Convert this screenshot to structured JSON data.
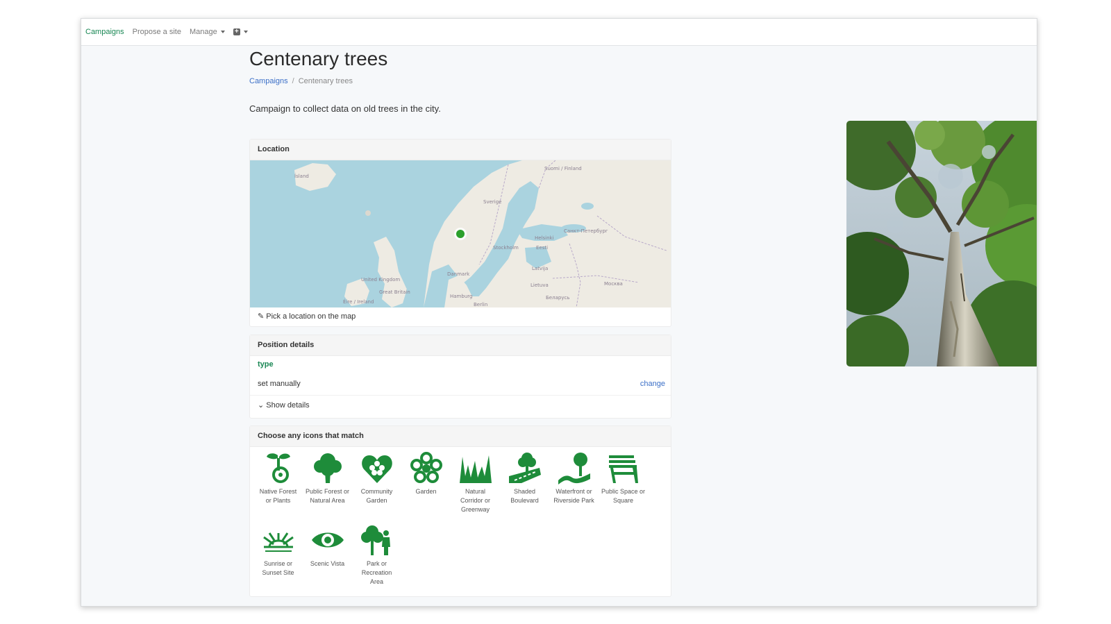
{
  "nav": {
    "campaigns": "Campaigns",
    "propose": "Propose a site",
    "manage": "Manage"
  },
  "page": {
    "title": "Centenary trees",
    "breadcrumb_root": "Campaigns",
    "breadcrumb_current": "Centenary trees",
    "description": "Campaign to collect data on old trees in the city."
  },
  "location": {
    "header": "Location",
    "pick_label": "Pick a location on the map",
    "map_labels": [
      "Ísland",
      "Sverige",
      "Suomi / Finland",
      "Stockholm",
      "Helsinki",
      "Eesti",
      "Latvija",
      "Lietuva",
      "Москва",
      "Danmark",
      "Hamburg",
      "Berlin",
      "Беларусь",
      "United Kingdom",
      "Great Britain",
      "Éire / Ireland",
      "Санкт-Петербург"
    ]
  },
  "position": {
    "header": "Position details",
    "type_label": "type",
    "type_value": "set manually",
    "change_label": "change",
    "show_details": "Show details"
  },
  "icons": {
    "header": "Choose any icons that match",
    "color": "#1e8c3a",
    "items": [
      {
        "icon": "sprout-icon",
        "label": "Native Forest or Plants"
      },
      {
        "icon": "tree-icon",
        "label": "Public Forest or Natural Area"
      },
      {
        "icon": "heart-flower-icon",
        "label": "Community Garden"
      },
      {
        "icon": "flower-icon",
        "label": "Garden"
      },
      {
        "icon": "grass-icon",
        "label": "Natural Corridor or Greenway"
      },
      {
        "icon": "boulevard-icon",
        "label": "Shaded Boulevard"
      },
      {
        "icon": "riverside-tree-icon",
        "label": "Waterfront or Riverside Park"
      },
      {
        "icon": "bench-icon",
        "label": "Public Space or Square"
      },
      {
        "icon": "sunrise-icon",
        "label": "Sunrise or Sunset Site"
      },
      {
        "icon": "eye-icon",
        "label": "Scenic Vista"
      },
      {
        "icon": "park-person-icon",
        "label": "Park or Recreation Area"
      }
    ]
  },
  "colors": {
    "accent": "#198754",
    "link": "#3b6fc7",
    "marker": "#2ca02c"
  }
}
